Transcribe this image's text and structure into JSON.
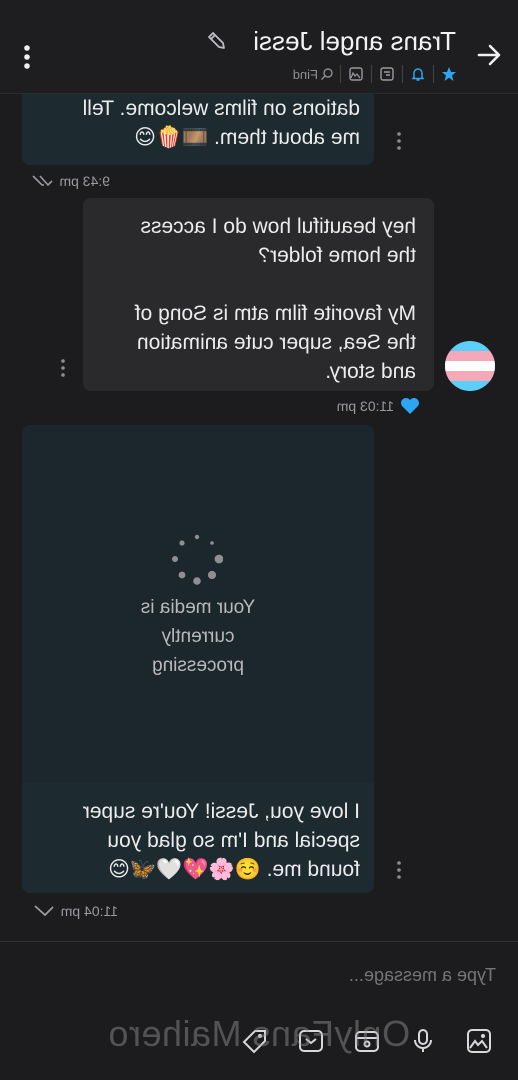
{
  "header": {
    "title": "Trans angel Jessi",
    "find_label": "Find"
  },
  "messages": [
    {
      "direction": "in",
      "text": "dations on films welcome. Tell\nme about them. 🎞️🍿😊",
      "time": "9:43 pm",
      "status": "read"
    },
    {
      "direction": "out",
      "text": "hey beautiful how do I access\nthe home folder?\n\nMy favorite film atm is Song of\nthe Sea, super cute animation\nand story.",
      "time": "11:03 pm",
      "liked": true
    },
    {
      "direction": "in",
      "media_status": "Your media is\ncurrently\nprocessing",
      "text": "I love you, Jessi! You're super\nspecial and I'm so glad you\nfound me. ☺️🌸💖🤍🦋😊",
      "time": "11:04 pm",
      "status": "sent"
    }
  ],
  "composer": {
    "placeholder": "Type a message..."
  },
  "watermark": "OnlyFans Maihero",
  "colors": {
    "accent": "#2aa6f5",
    "incoming_bubble": "#1d2a30",
    "outgoing_bubble": "#2a2a2c",
    "background": "#1c1c1e"
  },
  "icons": {
    "back": "arrow-right-icon",
    "edit": "pencil-icon",
    "star": "star-icon",
    "bell": "bell-icon",
    "menu": "more-vertical-icon"
  }
}
